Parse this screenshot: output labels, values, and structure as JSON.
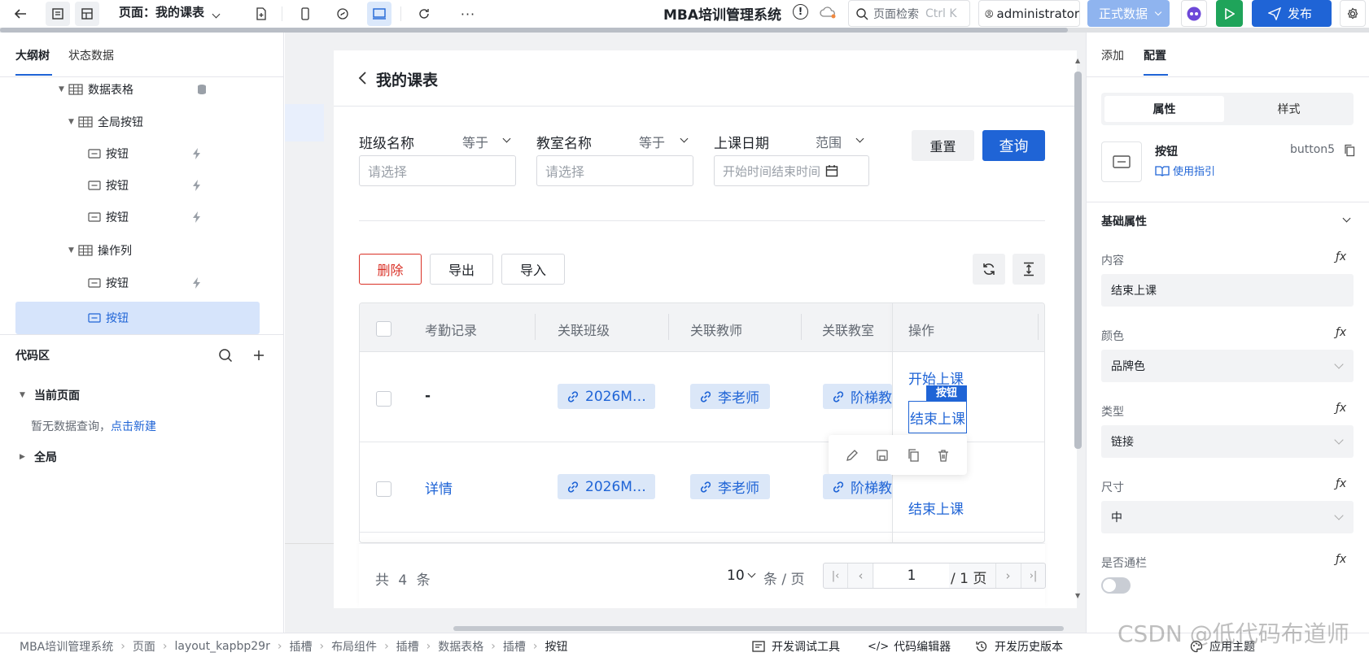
{
  "topbar": {
    "page_label": "页面：我的课表",
    "system_title": "MBA培训管理系统",
    "search_placeholder": "页面检索",
    "search_shortcut": "Ctrl K",
    "user": "administrator",
    "env_button": "正式数据",
    "publish_button": "发布",
    "progress_fraction": 0.78
  },
  "left_panel": {
    "tabs": [
      "大纲树",
      "状态数据"
    ],
    "tree": [
      {
        "label": "数据表格",
        "type": "table",
        "expanded": true
      },
      {
        "label": "全局按钮",
        "type": "table",
        "expanded": true
      },
      {
        "label": "按钮",
        "type": "button"
      },
      {
        "label": "按钮",
        "type": "button"
      },
      {
        "label": "按钮",
        "type": "button"
      },
      {
        "label": "操作列",
        "type": "table",
        "expanded": true
      },
      {
        "label": "按钮",
        "type": "button"
      },
      {
        "label": "按钮",
        "type": "button",
        "selected": true
      }
    ],
    "code_area_title": "代码区",
    "current_page": "当前页面",
    "no_query_text": "暂无数据查询，",
    "create_link": "点击新建",
    "global": "全局"
  },
  "canvas": {
    "page_title": "我的课表",
    "filters": [
      {
        "label": "班级名称",
        "operator": "等于",
        "placeholder": "请选择"
      },
      {
        "label": "教室名称",
        "operator": "等于",
        "placeholder": "请选择"
      },
      {
        "label": "上课日期",
        "operator": "范围",
        "placeholder": "开始时间结束时间"
      }
    ],
    "reset_button": "重置",
    "query_button": "查询",
    "delete_button": "删除",
    "export_button": "导出",
    "import_button": "导入",
    "table": {
      "headers": [
        "考勤记录",
        "关联班级",
        "关联教师",
        "关联教室",
        "操作"
      ],
      "rows": [
        {
          "attendance": "-",
          "class": "2026M…",
          "teacher": "李老师",
          "room": "阶梯教",
          "actions": [
            "开始上课",
            "结束上课"
          ]
        },
        {
          "attendance": "详情",
          "class": "2026M…",
          "teacher": "李老师",
          "room": "阶梯教",
          "actions": [
            "结束上课"
          ]
        }
      ],
      "selected_badge": "按钮"
    },
    "pagination": {
      "total": "共 4 条",
      "page_size": "10",
      "per_page": "条 / 页",
      "current_page": "1",
      "total_pages": "/ 1 页"
    }
  },
  "right_panel": {
    "tabs": [
      "添加",
      "配置"
    ],
    "subtabs": [
      "属性",
      "样式"
    ],
    "component_name": "按钮",
    "component_id": "button5",
    "guide_link": "使用指引",
    "section_title": "基础属性",
    "properties": [
      {
        "label": "内容",
        "value": "结束上课"
      },
      {
        "label": "颜色",
        "value": "品牌色"
      },
      {
        "label": "类型",
        "value": "链接"
      },
      {
        "label": "尺寸",
        "value": "中"
      }
    ],
    "toggle_label": "是否通栏",
    "toggle_on": false
  },
  "statusbar": {
    "breadcrumbs": [
      "MBA培训管理系统",
      "页面",
      "layout_kapbp29r",
      "插槽",
      "布局组件",
      "插槽",
      "数据表格",
      "插槽",
      "按钮"
    ],
    "dev_tools": "开发调试工具",
    "code_editor": "代码编辑器",
    "history": "开发历史版本",
    "theme": "应用主题"
  },
  "watermark": "CSDN @低代码布道师",
  "colors": {
    "brand": "#1f64d6",
    "danger": "#d93026",
    "selected_bg": "#d6e4fb"
  }
}
